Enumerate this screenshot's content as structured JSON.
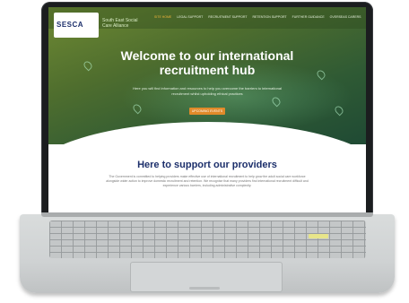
{
  "site": {
    "logo_text": "SESCA",
    "logo_subtitle": "South East Social Care Alliance",
    "nav": [
      {
        "label": "Site Home",
        "active": true
      },
      {
        "label": "Legal Support",
        "active": false
      },
      {
        "label": "Recruitment Support",
        "active": false
      },
      {
        "label": "Retention Support",
        "active": false
      },
      {
        "label": "Further Guidance",
        "active": false
      },
      {
        "label": "Overseas Carers",
        "active": false
      }
    ],
    "hero_title": "Welcome to our international recruitment hub",
    "hero_text": "Here you will find information and resources to help you overcome the barriers to international recruitment whilst upholding ethical practices",
    "hero_button": "Upcoming Events",
    "section_title": "Here to support our providers",
    "section_text": "The Government is committed to helping providers make effective use of international recruitment to help grow the adult social care workforce alongside wider action to improve domestic recruitment and retention. We recognise that many providers find international recruitment difficult and experience various barriers, including administrative complexity."
  },
  "colors": {
    "hero_green": "#4f6e2e",
    "title_navy": "#1c2f6b",
    "button_orange": "#e08a2a"
  }
}
